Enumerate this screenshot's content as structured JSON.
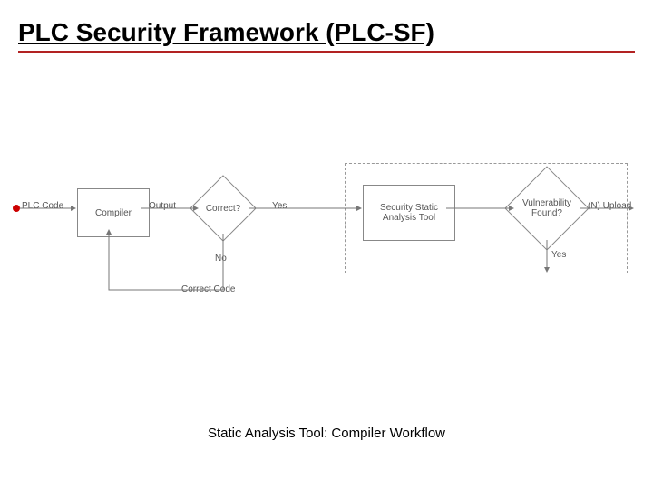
{
  "header": {
    "title": "PLC Security Framework (PLC-SF)"
  },
  "caption": "Static Analysis Tool: Compiler Workflow",
  "diagram": {
    "start_label": "PLC Code",
    "compiler_label": "Compiler",
    "output_label": "Output",
    "correct_q": "Correct?",
    "yes_label": "Yes",
    "no_label": "No",
    "correct_code_label": "Correct Code",
    "sast_label": "Security Static Analysis Tool",
    "vuln_q": "Vulnerability Found?",
    "upload_label": "(N) Upload",
    "yes2_label": "Yes"
  },
  "colors": {
    "title_underline": "#b22222",
    "node_border": "#888888",
    "dashed_border": "#999999",
    "start_bullet": "#cc0000",
    "text": "#555555"
  }
}
